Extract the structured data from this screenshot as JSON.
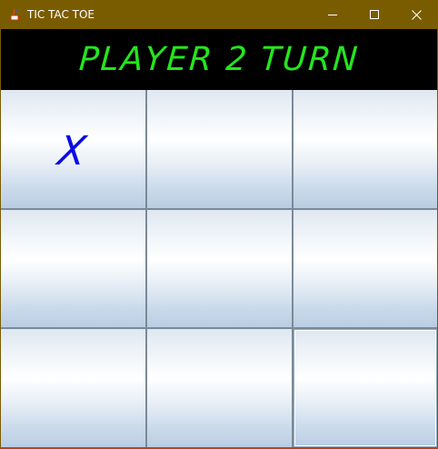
{
  "window": {
    "title": "TIC TAC TOE",
    "controls": {
      "minimize": "minimize-icon",
      "maximize": "maximize-icon",
      "close": "close-icon"
    }
  },
  "banner": {
    "text": "PLAYER 2 TURN",
    "color": "#23e61e"
  },
  "board": {
    "cells": [
      {
        "value": "X"
      },
      {
        "value": ""
      },
      {
        "value": ""
      },
      {
        "value": ""
      },
      {
        "value": ""
      },
      {
        "value": ""
      },
      {
        "value": ""
      },
      {
        "value": ""
      },
      {
        "value": ""
      }
    ],
    "mark_color": "#0a0ae6"
  }
}
